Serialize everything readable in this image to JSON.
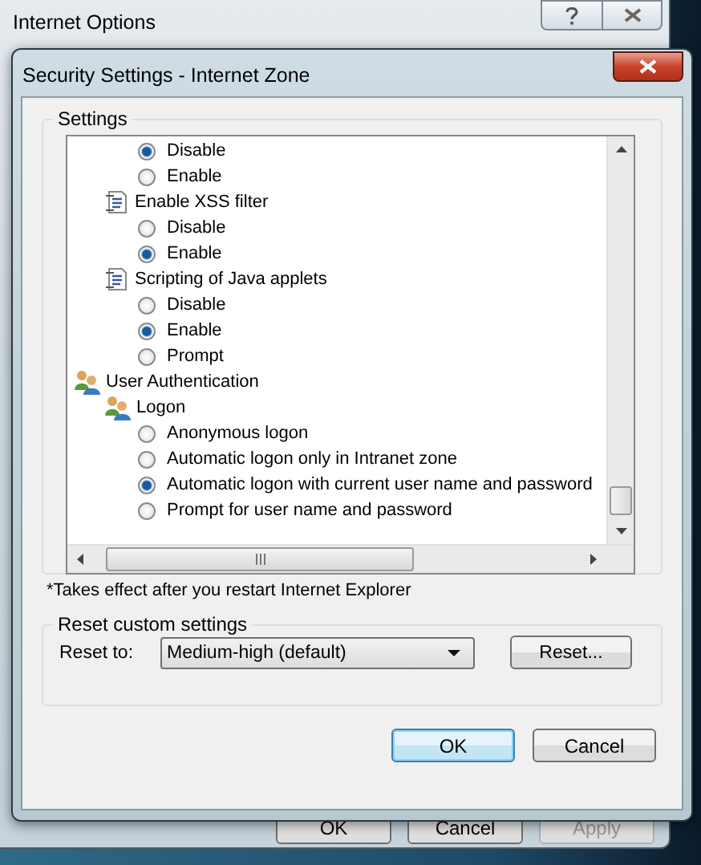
{
  "back_window": {
    "title": "Internet Options",
    "buttons": [
      {
        "label": "OK",
        "disabled": false
      },
      {
        "label": "Cancel",
        "disabled": false
      },
      {
        "label": "Apply",
        "disabled": true
      }
    ]
  },
  "dialog": {
    "title": "Security Settings - Internet Zone",
    "settings": {
      "label": "Settings",
      "tree": [
        {
          "children": [
            {
              "children": [
                {
                  "kind": "radio",
                  "label": "Disable",
                  "selected": true
                },
                {
                  "kind": "radio",
                  "label": "Enable",
                  "selected": false
                }
              ]
            },
            {
              "kind": "setting",
              "label": "Enable XSS filter",
              "children": [
                {
                  "kind": "radio",
                  "label": "Disable",
                  "selected": false
                },
                {
                  "kind": "radio",
                  "label": "Enable",
                  "selected": true
                }
              ]
            },
            {
              "kind": "setting",
              "label": "Scripting of Java applets",
              "children": [
                {
                  "kind": "radio",
                  "label": "Disable",
                  "selected": false
                },
                {
                  "kind": "radio",
                  "label": "Enable",
                  "selected": true
                },
                {
                  "kind": "radio",
                  "label": "Prompt",
                  "selected": false
                }
              ]
            }
          ]
        },
        {
          "kind": "group",
          "label": "User Authentication",
          "children": [
            {
              "kind": "group",
              "label": "Logon",
              "children": [
                {
                  "kind": "radio",
                  "label": "Anonymous logon",
                  "selected": false
                },
                {
                  "kind": "radio",
                  "label": "Automatic logon only in Intranet zone",
                  "selected": false
                },
                {
                  "kind": "radio",
                  "label": "Automatic logon with current user name and password",
                  "selected": true
                },
                {
                  "kind": "radio",
                  "label": "Prompt for user name and password",
                  "selected": false
                }
              ]
            }
          ]
        }
      ],
      "note": "*Takes effect after you restart Internet Explorer"
    },
    "reset": {
      "label": "Reset custom settings",
      "reset_to_label": "Reset to:",
      "value": "Medium-high (default)",
      "button": "Reset..."
    },
    "buttons": [
      {
        "label": "OK",
        "default": true
      },
      {
        "label": "Cancel",
        "default": false
      }
    ]
  }
}
